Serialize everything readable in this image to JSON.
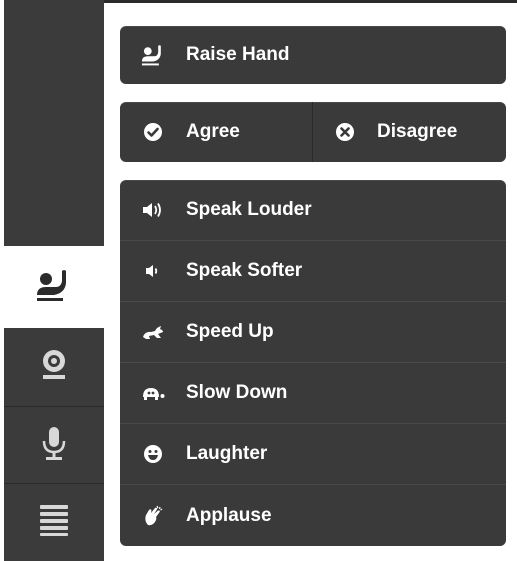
{
  "sidebar": {
    "tabs": [
      {
        "icon": "raise-hand-icon",
        "active": true
      },
      {
        "icon": "webcam-icon",
        "active": false
      },
      {
        "icon": "microphone-icon",
        "active": false
      },
      {
        "icon": "menu-list-icon",
        "active": false
      }
    ]
  },
  "raise_hand": {
    "label": "Raise Hand",
    "icon": "raise-hand-icon"
  },
  "vote": {
    "agree": {
      "label": "Agree",
      "icon": "check-circle-icon"
    },
    "disagree": {
      "label": "Disagree",
      "icon": "x-circle-icon"
    }
  },
  "feedback": {
    "items": [
      {
        "label": "Speak Louder",
        "icon": "speaker-loud-icon"
      },
      {
        "label": "Speak Softer",
        "icon": "speaker-soft-icon"
      },
      {
        "label": "Speed Up",
        "icon": "rabbit-icon"
      },
      {
        "label": "Slow Down",
        "icon": "turtle-icon"
      },
      {
        "label": "Laughter",
        "icon": "smiley-icon"
      },
      {
        "label": "Applause",
        "icon": "clapping-hands-icon"
      }
    ]
  },
  "colors": {
    "panel": "#3a3a3a",
    "sidebar": "#3b3b3b",
    "active_tab": "#ffffff",
    "text": "#ffffff"
  }
}
